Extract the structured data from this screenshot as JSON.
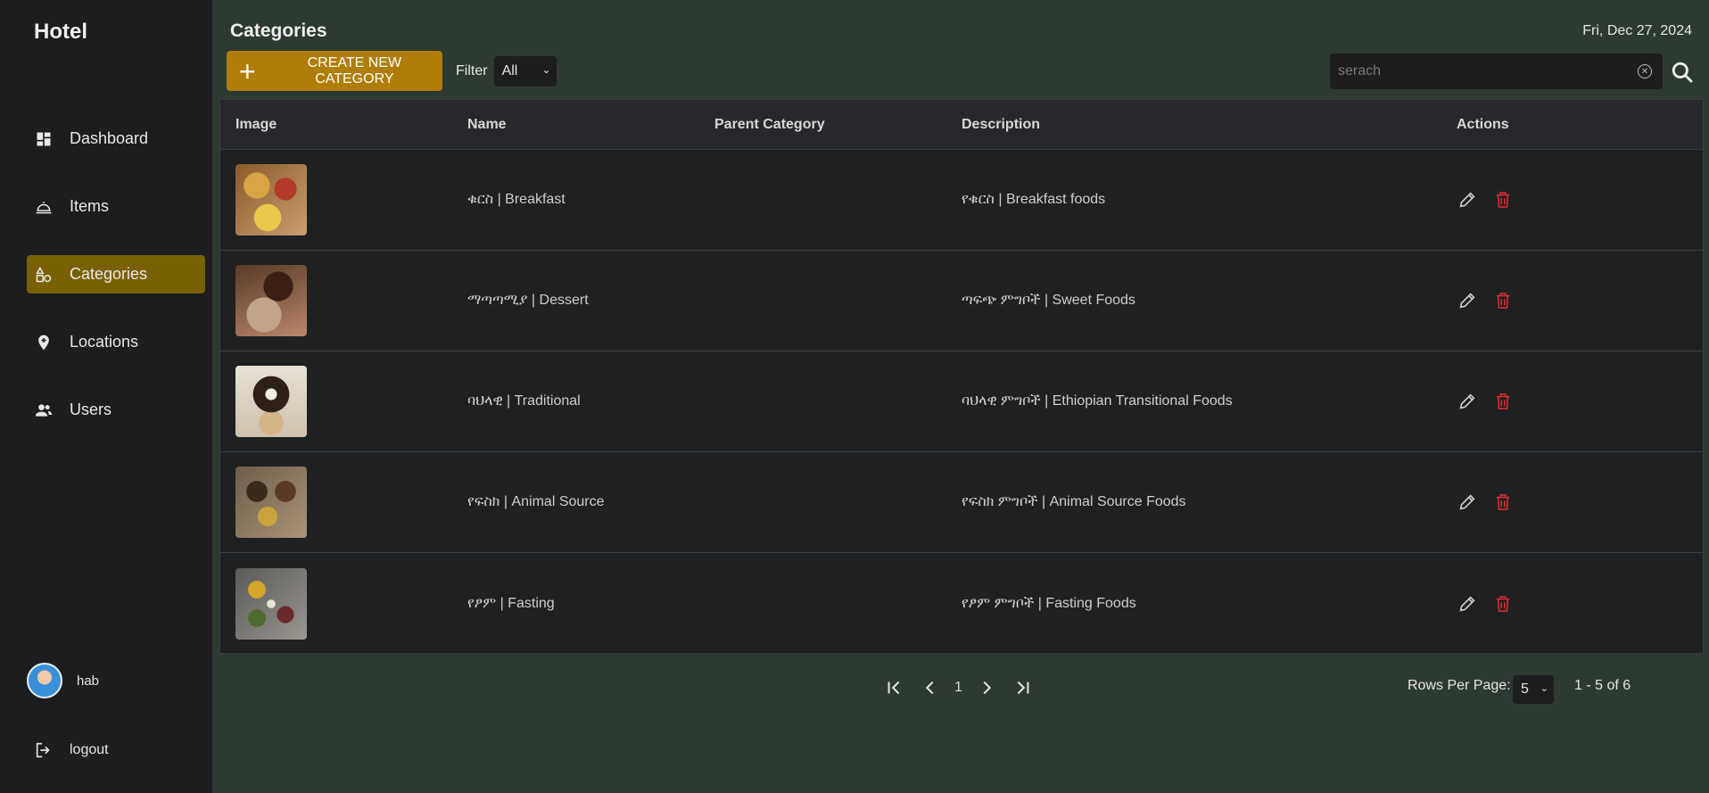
{
  "app": {
    "brand": "Hotel"
  },
  "sidebar": {
    "items": [
      {
        "label": "Dashboard",
        "icon": "dashboard-icon",
        "active": false
      },
      {
        "label": "Items",
        "icon": "cloche-icon",
        "active": false
      },
      {
        "label": "Categories",
        "icon": "category-icon",
        "active": true
      },
      {
        "label": "Locations",
        "icon": "location-pin-icon",
        "active": false
      },
      {
        "label": "Users",
        "icon": "users-icon",
        "active": false
      }
    ],
    "user": {
      "name": "hab"
    },
    "logout_label": "logout"
  },
  "header": {
    "title": "Categories",
    "date": "Fri, Dec 27, 2024"
  },
  "toolbar": {
    "create_label": "CREATE NEW CATEGORY",
    "filter_label": "Filter",
    "filter_value": "All",
    "search_placeholder": "serach"
  },
  "table": {
    "columns": [
      "Image",
      "Name",
      "Parent Category",
      "Description",
      "Actions"
    ],
    "rows": [
      {
        "name": "ቁርስ | Breakfast",
        "parent": "",
        "description": "የቁርስ | Breakfast foods"
      },
      {
        "name": "ማጣጣሚያ | Dessert",
        "parent": "",
        "description": "ጣፍጭ ምግቦች | Sweet Foods"
      },
      {
        "name": "ባህላዊ | Traditional",
        "parent": "",
        "description": "ባህላዊ ምግቦች | Ethiopian Transitional Foods"
      },
      {
        "name": "የፍስክ | Animal Source",
        "parent": "",
        "description": "የፍስክ ምግቦች | Animal Source Foods"
      },
      {
        "name": "የፆም | Fasting",
        "parent": "",
        "description": "የፆም ምግቦች | Fasting Foods"
      }
    ]
  },
  "pagination": {
    "page": "1",
    "rows_per_page_label": "Rows Per Page:",
    "rows_per_page": "5",
    "range": "1 - 5 of 6"
  },
  "colors": {
    "accent": "#b07d08",
    "active_nav": "#7a6005",
    "background": "#2d3a31",
    "sidebar": "#1c1d1f",
    "delete": "#d32f2f"
  }
}
